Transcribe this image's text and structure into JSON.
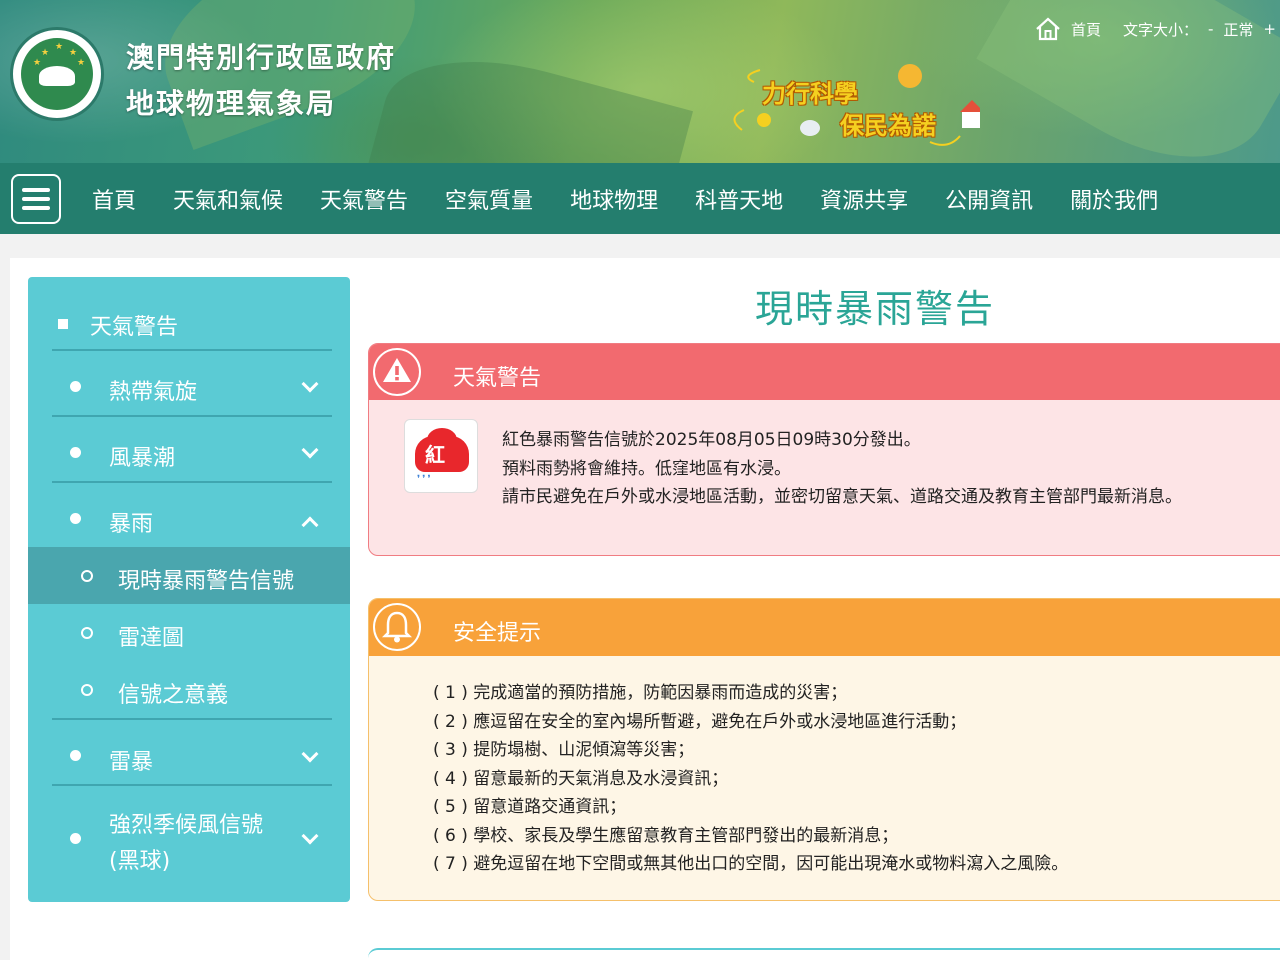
{
  "header": {
    "org_line1": "澳門特別行政區政府",
    "org_line2": "地球物理氣象局",
    "slogan_line1": "力行科學",
    "slogan_line2": "保民為諾",
    "top_links": {
      "home": "首頁",
      "font_size_label": "文字大小：",
      "decrease": "-",
      "normal": "正常",
      "increase": "+"
    }
  },
  "nav": {
    "items": [
      "首頁",
      "天氣和氣候",
      "天氣警告",
      "空氣質量",
      "地球物理",
      "科普天地",
      "資源共享",
      "公開資訊",
      "關於我們"
    ]
  },
  "sidebar": {
    "heading": "天氣警告",
    "items": [
      {
        "label": "熱帶氣旋",
        "state": "collapsed"
      },
      {
        "label": "風暴潮",
        "state": "collapsed"
      },
      {
        "label": "暴雨",
        "state": "expanded"
      },
      {
        "label": "雷暴",
        "state": "collapsed"
      },
      {
        "label": "強烈季候風信號(黑球)",
        "state": "collapsed"
      }
    ],
    "subitems": [
      "現時暴雨警告信號",
      "雷達圖",
      "信號之意義"
    ],
    "active_subitem": "現時暴雨警告信號"
  },
  "page": {
    "title": "現時暴雨警告"
  },
  "warning_panel": {
    "title": "天氣警告",
    "icon_text": "紅",
    "lines": [
      "紅色暴雨警告信號於2025年08月05日09時30分發出。",
      "預料雨勢將會維持。低窪地區有水浸。",
      "請市民避免在戶外或水浸地區活動，並密切留意天氣、道路交通及教育主管部門最新消息。"
    ]
  },
  "safety_panel": {
    "title": "安全提示",
    "tips": [
      "( 1 ) 完成適當的預防措施，防範因暴雨而造成的災害；",
      "( 2 ) 應逗留在安全的室內場所暫避，避免在戶外或水浸地區進行活動；",
      "( 3 ) 提防塌樹、山泥傾瀉等災害；",
      "( 4 ) 留意最新的天氣消息及水浸資訊；",
      "( 5 ) 留意道路交通資訊；",
      "( 6 ) 學校、家長及學生應留意教育主管部門發出的最新消息；",
      "( 7 ) 避免逗留在地下空間或無其他出口的空間，因可能出現淹水或物料瀉入之風險。"
    ]
  },
  "colors": {
    "nav_bg": "#247e6e",
    "sidebar_bg": "#5bcbd4",
    "title_teal": "#2aa596",
    "warning_red": "#f26a6f",
    "safety_orange": "#f8a23a"
  }
}
